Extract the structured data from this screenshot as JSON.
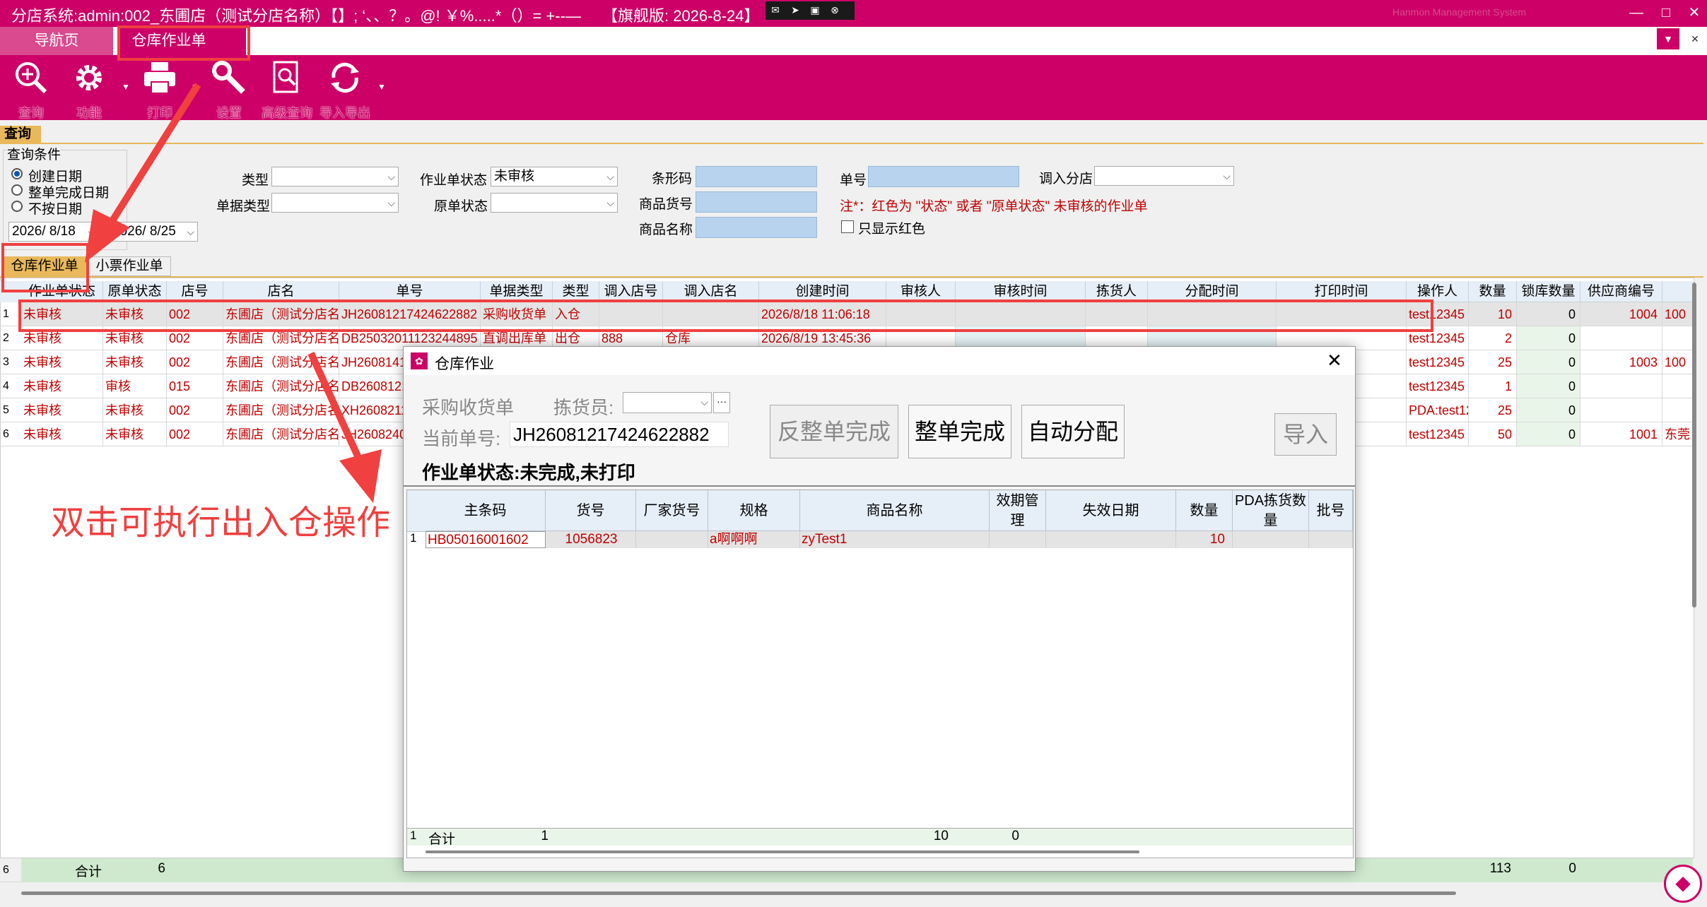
{
  "window": {
    "title": "分店系统:admin:002_东圃店（测试分店名称）【】;  ‘、、？。@! ￥%.....*（）= +--—",
    "edition": "【旗舰版: 2026-8-24】",
    "bg_text": "Hanmon Management System",
    "minimize": "—",
    "maximize": "□",
    "close": "✕"
  },
  "tabs": {
    "nav": "导航页",
    "main": "仓库作业单",
    "close": "×"
  },
  "toolbar": [
    {
      "label": "查询",
      "icon": "zoom-in-icon"
    },
    {
      "label": "功能",
      "icon": "gear-icon"
    },
    {
      "label": "打印",
      "icon": "printer-icon"
    },
    {
      "label": "设置",
      "icon": "wrench-icon"
    },
    {
      "label": "高级查询",
      "icon": "advanced-search-icon"
    },
    {
      "label": "导入导出",
      "icon": "refresh-icon"
    }
  ],
  "query": {
    "section_tab": "查询",
    "group_title": "查询条件",
    "date_options": [
      "创建日期",
      "整单完成日期",
      "不按日期"
    ],
    "date_from": "2026/ 8/18",
    "date_sep": "~",
    "date_to": "2026/ 8/25",
    "type_label": "类型",
    "type_value": "",
    "doc_type_label": "单据类型",
    "doc_type_value": "",
    "job_status_label": "作业单状态",
    "job_status_value": "未审核",
    "orig_status_label": "原单状态",
    "orig_status_value": "",
    "barcode_label": "条形码",
    "item_no_label": "商品货号",
    "item_name_label": "商品名称",
    "order_no_label": "单号",
    "in_store_label": "调入分店",
    "in_store_value": "",
    "note": "注*：红色为 \"状态\" 或者 \"原单状态\" 未审核的作业单",
    "only_red_label": "只显示红色"
  },
  "subtabs": [
    "仓库作业单",
    "小票作业单"
  ],
  "grid": {
    "headers": [
      "作业单状态",
      "原单状态",
      "店号",
      "店名",
      "单号",
      "单据类型",
      "类型",
      "调入店号",
      "调入店名",
      "创建时间",
      "审核人",
      "审核时间",
      "拣货人",
      "分配时间",
      "打印时间",
      "操作人",
      "数量",
      "锁库数量",
      "供应商编号",
      ""
    ],
    "rows": [
      {
        "n": "1",
        "c": [
          "未审核",
          "未审核",
          "002",
          "东圃店（测试分店名",
          "JH26081217424622882",
          "采购收货单",
          "入仓",
          "",
          "",
          "2026/8/18 11:06:18",
          "",
          "",
          "",
          "",
          "",
          "test12345",
          "10",
          "0",
          "1004",
          "100"
        ]
      },
      {
        "n": "2",
        "c": [
          "未审核",
          "未审核",
          "002",
          "东圃店（测试分店名",
          "DB25032011123244895",
          "直调出库单",
          "出仓",
          "888",
          "仓库",
          "2026/8/19 13:45:36",
          "",
          "",
          "",
          "",
          "",
          "test12345",
          "2",
          "0",
          "",
          ""
        ]
      },
      {
        "n": "3",
        "c": [
          "未审核",
          "未审核",
          "002",
          "东圃店（测试分店名",
          "JH26081412",
          "",
          "",
          "",
          "",
          "",
          "",
          "",
          "",
          "",
          "",
          "test12345",
          "25",
          "0",
          "1003",
          "100"
        ]
      },
      {
        "n": "4",
        "c": [
          "未审核",
          "审核",
          "015",
          "东圃店（测试分店名",
          "DB26081211",
          "",
          "",
          "",
          "",
          "",
          "",
          "",
          "",
          "",
          "",
          "test12345",
          "1",
          "0",
          "",
          ""
        ]
      },
      {
        "n": "5",
        "c": [
          "未审核",
          "未审核",
          "002",
          "东圃店（测试分店名",
          "XH26082111",
          "",
          "",
          "",
          "",
          "",
          "",
          "",
          "",
          "",
          "",
          "PDA:test12",
          "25",
          "0",
          "",
          ""
        ]
      },
      {
        "n": "6",
        "c": [
          "未审核",
          "未审核",
          "002",
          "东圃店（测试分店名",
          "JH26082401",
          "",
          "",
          "",
          "",
          "",
          "",
          "",
          "",
          "",
          "",
          "test12345",
          "50",
          "0",
          "1001",
          "东莞"
        ]
      }
    ],
    "footer": {
      "count": "6",
      "label": "合计",
      "rows": "6",
      "qty": "113",
      "lock": "0"
    }
  },
  "annotation": "双击可执行出入仓操作",
  "dialog": {
    "title": "仓库作业",
    "close": "✕",
    "doc_type": "采购收货单",
    "picker_label": "拣货员:",
    "picker_value": "",
    "current_label": "当前单号:",
    "current_value": "JH26081217424622882",
    "status": "作业单状态:未完成,未打印",
    "btn_reverse": "反整单完成",
    "btn_complete": "整单完成",
    "btn_auto": "自动分配",
    "btn_import": "导入",
    "headers": [
      "主条码",
      "货号",
      "厂家货号",
      "规格",
      "商品名称",
      "效期管理",
      "失效日期",
      "数量",
      "PDA拣货数量",
      "批号"
    ],
    "rows": [
      {
        "n": "1",
        "c": [
          "HB05016001602",
          "1056823",
          "",
          "a啊啊啊",
          "zyTest1",
          "",
          "",
          "10",
          "",
          ""
        ]
      }
    ],
    "footer": {
      "n": "1",
      "label": "合计",
      "count": "1",
      "qty": "10",
      "pda": "0"
    }
  },
  "colors": {
    "brand": "#cc0066",
    "accent": "#e8b85a",
    "highlight": "#f04040",
    "red_text": "#c00000"
  }
}
